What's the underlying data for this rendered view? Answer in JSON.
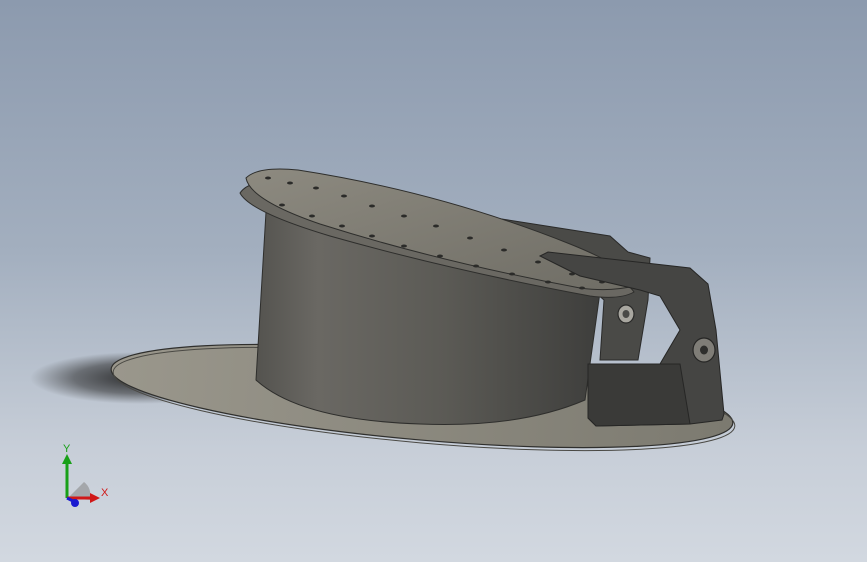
{
  "scene": {
    "background_top": "#8c9aae",
    "background_bottom": "#d2d8e0",
    "part_color": "#5e5d58",
    "plate_color": "#8a877c",
    "dark_metal": "#3f3f3d"
  },
  "triad": {
    "x_label": "X",
    "y_label": "Y",
    "x_color": "#d01818",
    "y_color": "#18a018",
    "z_color": "#1a1ad0"
  }
}
